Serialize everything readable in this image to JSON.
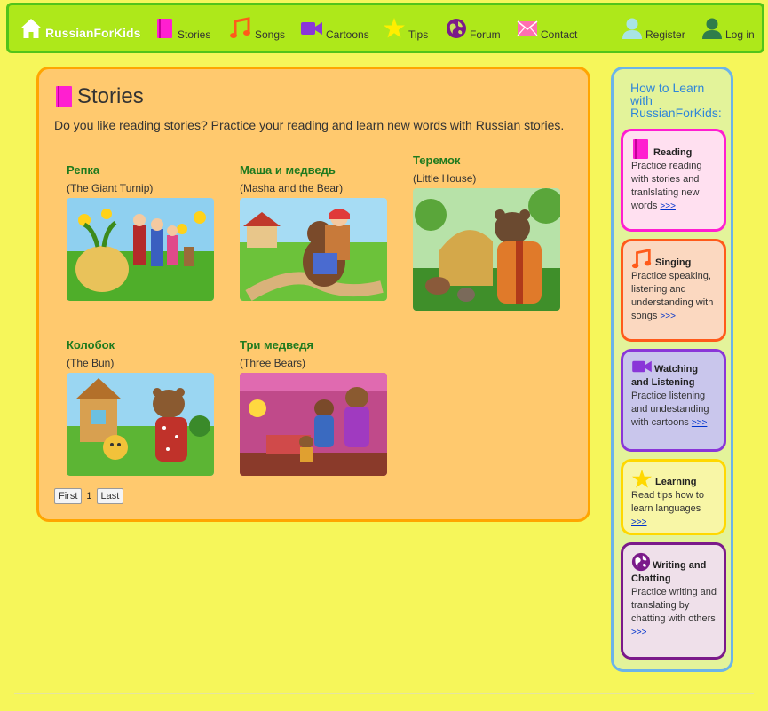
{
  "nav": {
    "brand": "RussianForKids",
    "items": [
      {
        "label": "Stories",
        "icon": "book-icon"
      },
      {
        "label": "Songs",
        "icon": "music-note-icon"
      },
      {
        "label": "Cartoons",
        "icon": "video-camera-icon"
      },
      {
        "label": "Tips",
        "icon": "star-icon"
      },
      {
        "label": "Forum",
        "icon": "globe-icon"
      },
      {
        "label": "Contact",
        "icon": "envelope-icon"
      }
    ],
    "register": "Register",
    "login": "Log in"
  },
  "main": {
    "title": "Stories",
    "intro": "Do you like reading stories? Practice your reading and learn new words with Russian stories.",
    "stories": [
      {
        "title": "Репка",
        "subtitle": "(The Giant Turnip)"
      },
      {
        "title": "Маша и медведь",
        "subtitle": "(Masha and the Bear)"
      },
      {
        "title": "Теремок",
        "subtitle": "(Little House)"
      },
      {
        "title": "Колобок",
        "subtitle": "(The Bun)"
      },
      {
        "title": "Три медведя",
        "subtitle": "(Three Bears)"
      }
    ],
    "pager": {
      "first": "First",
      "current": "1",
      "last": "Last"
    }
  },
  "sidebar": {
    "heading": "How to Learn with RussianForKids:",
    "cards": [
      {
        "title": "Reading",
        "text": "Practice reading with stories and tranlslating new words",
        "more": ">>>",
        "icon": "book-icon"
      },
      {
        "title": "Singing",
        "text": "Practice speaking, listening and understanding with songs",
        "more": ">>>",
        "icon": "music-note-icon"
      },
      {
        "title": "Watching and Listening",
        "text": "Practice listening and undestanding with cartoons",
        "more": ">>>",
        "icon": "video-camera-icon"
      },
      {
        "title": "Learning",
        "text": "Read tips how to learn languages",
        "more": ">>>",
        "icon": "star-icon"
      },
      {
        "title": "Writing and Chatting",
        "text": "Practice writing and translating by chatting with others",
        "more": ">>>",
        "icon": "globe-icon"
      }
    ]
  },
  "colors": {
    "page_bg": "#f6f65a",
    "nav_bg": "#aee81a",
    "main_bg": "#ffc96e",
    "story_title": "#1e7a1e",
    "reading": "#ff1fd0",
    "singing": "#ff5a1a",
    "watching": "#8a36d8",
    "learning": "#ffd800",
    "writing": "#7b1a8a"
  }
}
